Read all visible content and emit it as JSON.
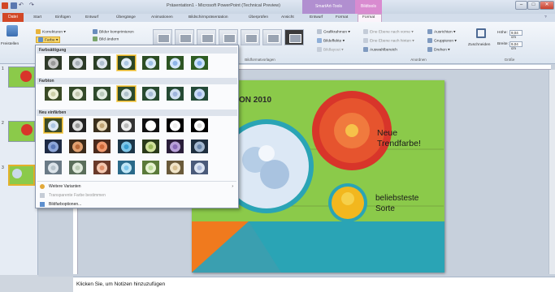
{
  "titlebar": {
    "title": "Präsentation1 - Microsoft PowerPoint (Technical Preview)",
    "context_tab_group_1": "SmartArt-Tools",
    "context_tab_group_2": "Bildtools",
    "minimize": "–",
    "maximize": "□",
    "close": "✕"
  },
  "tabs": {
    "file": "Datei",
    "items": [
      "Start",
      "Einfügen",
      "Entwurf",
      "Übergänge",
      "Animationen",
      "Bildschirmpräsentation",
      "Überprüfen",
      "Ansicht",
      "Entwurf",
      "Format",
      "Format"
    ]
  },
  "ribbon": {
    "freistellen": "Freistellen",
    "korrekturen": "Korrekturen",
    "farbe": "Farbe",
    "bilder_komprimieren": "Bilder komprimieren",
    "bild_andern": "Bild ändern",
    "bildformatvorlagen": "Bildformatvorlagen",
    "grafikrahmen": "Grafikrahmen",
    "grafikeffekte": "Bildeffekte",
    "bildlayout": "Bildlayout",
    "ebene_vorne": "Eine Ebene nach vorne",
    "ebene_hinten": "Eine Ebene nach hinten",
    "auswahlbereich": "Auswahlbereich",
    "ausrichten": "Ausrichten",
    "gruppieren": "Gruppieren",
    "drehen": "Drehen",
    "anordnen": "Anordnen",
    "zuschneiden": "Zuschneiden",
    "hoehe_label": "Höhe:",
    "hoehe_value": "9,04 cm",
    "breite_label": "Breite:",
    "breite_value": "9,04 cm",
    "groesse": "Größe"
  },
  "dropdown": {
    "section_saturation": "Farbsättigung",
    "section_tone": "Farbton",
    "section_recolor": "Neu einfärben",
    "more_variants": "Weitere Varianten",
    "set_transparent": "Transparente Farbe bestimmen",
    "picture_options": "Bildfarboptionen..."
  },
  "slides": {
    "numbers": [
      "1",
      "2",
      "3"
    ]
  },
  "slide": {
    "title": "ON 2010",
    "new_color": [
      "Neue",
      "Trendfarbe!"
    ],
    "favorite": [
      "beliebsteste",
      "Sorte"
    ]
  },
  "notes": {
    "placeholder": "Klicken Sie, um Notizen hinzuzufügen"
  },
  "colors": {
    "file_tab": "#d24726",
    "slide_bg": "#8bca4a",
    "teal": "#2aa4b5",
    "orange": "#f07a1e",
    "selection_gold": "#e3b12a"
  }
}
